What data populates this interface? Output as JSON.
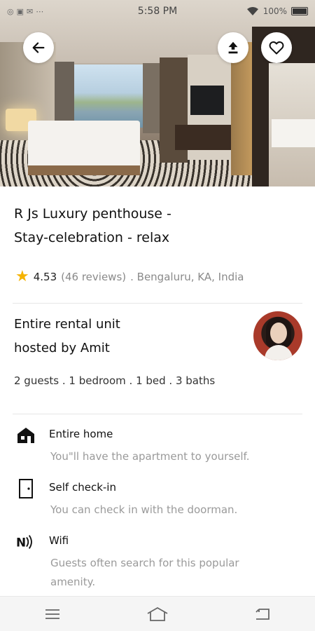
{
  "status_bar": {
    "time": "5:58 PM",
    "battery": "100%",
    "left_icons": [
      "notification-icon",
      "sim-icon",
      "message-icon",
      "more-icon"
    ]
  },
  "hero": {
    "buttons": {
      "back_icon": "arrow-left-icon",
      "share_icon": "upload-icon",
      "favorite_icon": "heart-icon"
    }
  },
  "listing": {
    "title_line1": "R Js Luxury penthouse -",
    "title_line2": "Stay-celebration - relax",
    "rating": "4.53",
    "reviews": "(46 reviews)",
    "location": ". Bengaluru, KA, India"
  },
  "host": {
    "line1": "Entire rental unit",
    "line2": "hosted by Amit",
    "specs": "2 guests . 1 bedroom . 1 bed . 3 baths"
  },
  "features": [
    {
      "icon": "home-icon",
      "title": "Entire home",
      "desc": "You\"ll have the apartment to yourself."
    },
    {
      "icon": "door-icon",
      "title": "Self check-in",
      "desc": "You can check in with the doorman."
    },
    {
      "icon": "wifi-icon",
      "title": "Wifi",
      "desc": "Guests often search for this popular amenity."
    }
  ],
  "nav": {
    "icons": [
      "menu-icon",
      "home-nav-icon",
      "back-nav-icon"
    ]
  },
  "colors": {
    "star": "#f5b301",
    "muted_text": "#8a8a8a",
    "title_text": "#111111"
  }
}
